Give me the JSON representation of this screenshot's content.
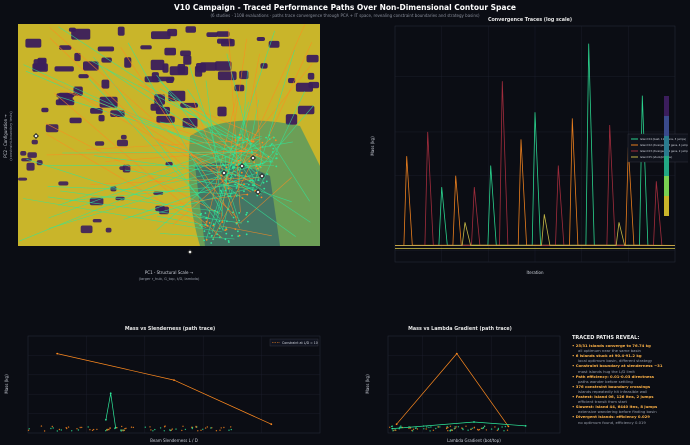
{
  "page": {
    "title": "V10 Campaign - Traced Performance Paths Over Non-Dimensional Contour Space",
    "subtitle": "(6 studies · 1108 evaluations · paths trace convergence through PCA + IT space, revealing constraint boundaries and strategy basins)"
  },
  "colors": {
    "background": "#0b0d14",
    "panel": "#0b0d14",
    "contour_low": "#3b1d5c",
    "contour_mid": "#1f8a7a",
    "contour_high": "#c9b52a",
    "trace_green": "#2ee89a",
    "trace_orange": "#ff8a1f",
    "trace_red": "#b03040"
  },
  "chart_data": [
    {
      "id": "pca-contour",
      "type": "scatter",
      "title": "",
      "xlabel": "PC1 - Structural Scale →",
      "xlabel2": "(larger r_hub, G_top, t/D, lambda)",
      "ylabel": "PC2 - Configuration →",
      "ylabel2": "(constraint-boundary tests)",
      "grid": false,
      "legend": "none"
    },
    {
      "id": "convergence",
      "type": "line",
      "title": "Convergence Traces (log scale)",
      "xlabel": "Iteration",
      "ylabel": "Mass (kg)",
      "yscale": "log",
      "grid": true,
      "legend": "center-right",
      "series": [
        {
          "name": "Island 04 (best, 112 gens, 3 jumps)",
          "color": "#2ee89a",
          "peaks": [
            {
              "x": 1000,
              "y": 1.8
            },
            {
              "x": 2050,
              "y": 2.2
            },
            {
              "x": 3000,
              "y": 3.6
            },
            {
              "x": 4150,
              "y": 6.8
            },
            {
              "x": 5300,
              "y": 4.2
            }
          ]
        },
        {
          "name": "Island 02 (diverged, 48 gens, 4 jumps)",
          "color": "#ff8a1f",
          "peaks": [
            {
              "x": 250,
              "y": 2.4
            },
            {
              "x": 1300,
              "y": 2.0
            },
            {
              "x": 2700,
              "y": 2.8
            },
            {
              "x": 3800,
              "y": 3.4
            },
            {
              "x": 5000,
              "y": 2.6
            }
          ]
        },
        {
          "name": "Island 03 (diverged, 29 gens, 2 jumps)",
          "color": "#b03040",
          "peaks": [
            {
              "x": 700,
              "y": 3.0
            },
            {
              "x": 1700,
              "y": 1.8
            },
            {
              "x": 2300,
              "y": 4.8
            },
            {
              "x": 3500,
              "y": 2.2
            },
            {
              "x": 4600,
              "y": 3.2
            },
            {
              "x": 5600,
              "y": 1.9
            }
          ]
        },
        {
          "name": "Island 05 (stuck/plateau)",
          "color": "#d8c94a",
          "peaks": [
            {
              "x": 1500,
              "y": 1.3
            },
            {
              "x": 3200,
              "y": 1.4
            },
            {
              "x": 4800,
              "y": 1.3
            }
          ]
        }
      ]
    },
    {
      "id": "mass-slenderness",
      "type": "scatter",
      "title": "Mass vs Slenderness (path trace)",
      "xlabel": "Beam Slenderness L / D",
      "ylabel": "Mass (kg)",
      "legend": "top-right",
      "legend_label": "Constraint at L/D = 10",
      "series": [
        {
          "name": "orange path",
          "points": [
            [
              3,
              1800
            ],
            [
              15,
              1200
            ],
            [
              25,
              200
            ]
          ]
        },
        {
          "name": "green path",
          "points": [
            [
              8,
              300
            ],
            [
              8.5,
              900
            ],
            [
              9,
              120
            ]
          ]
        }
      ]
    },
    {
      "id": "mass-lambda",
      "type": "scatter",
      "title": "Mass vs Lambda Gradient (path trace)",
      "xlabel": "Lambda Gradient (bot/top)",
      "ylabel": "Mass (kg)",
      "legend": "none",
      "series": [
        {
          "name": "orange path",
          "points": [
            [
              0.2,
              200
            ],
            [
              1.6,
              1800
            ],
            [
              2.8,
              150
            ]
          ]
        },
        {
          "name": "green path",
          "points": [
            [
              0.1,
              100
            ],
            [
              2.0,
              250
            ],
            [
              3.2,
              160
            ]
          ]
        }
      ]
    }
  ],
  "notes": {
    "header": "TRACED PATHS REVEAL:",
    "items": [
      {
        "line": "• 25/31 islands converge to 76.74 kg",
        "sub": "all optimum near the same basin"
      },
      {
        "line": "• 6 islands stuck at 90.4-91.2 kg",
        "sub": "local optimum basin, different strategy"
      },
      {
        "line": "• Constraint boundary at slenderness ~31",
        "sub": "most islands hug the L/D limit"
      },
      {
        "line": "• Path efficiency: 0.01-0.03 directness",
        "sub": "paths wander before settling"
      },
      {
        "line": "• 376 constraint boundary crossings",
        "sub": "islands repeatedly hit infeasible wall"
      },
      {
        "line": "• Fastest: island 06, 126 itns, 2 jumps",
        "sub": "efficient transit from start"
      },
      {
        "line": "• Slowest: island 44, 6440 itns, 8 jumps",
        "sub": "extensive wandering before finding basin"
      },
      {
        "line": "• Divergent islands: efficiency 0.029",
        "sub": "no optimum found, efficiency 0.019"
      }
    ]
  }
}
